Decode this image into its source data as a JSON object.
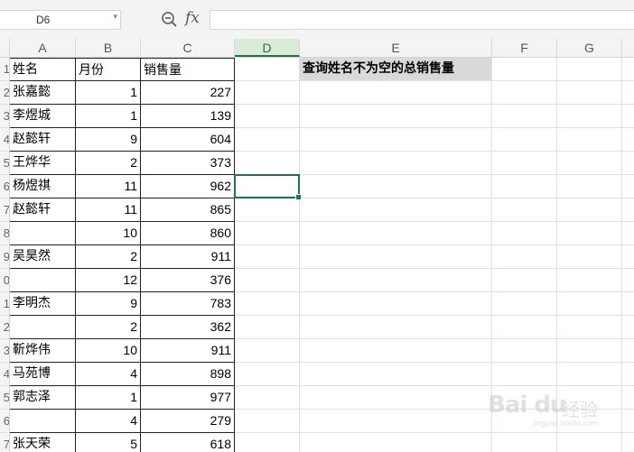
{
  "formula_bar": {
    "name_box": "D6",
    "fx_label": "fx",
    "formula": ""
  },
  "columns": [
    "A",
    "B",
    "C",
    "D",
    "E",
    "F",
    "G"
  ],
  "active_column": "D",
  "active_cell": "D6",
  "row_numbers": [
    "1",
    "2",
    "3",
    "4",
    "5",
    "6",
    "7",
    "8",
    "9",
    "0",
    "1",
    "2",
    "3",
    "4",
    "5",
    "6",
    "7"
  ],
  "table": {
    "headers": [
      "姓名",
      "月份",
      "销售量"
    ],
    "rows": [
      {
        "name": "张嘉懿",
        "month": "1",
        "sales": "227"
      },
      {
        "name": "李煜城",
        "month": "1",
        "sales": "139"
      },
      {
        "name": "赵懿轩",
        "month": "9",
        "sales": "604"
      },
      {
        "name": "王烨华",
        "month": "2",
        "sales": "373"
      },
      {
        "name": "杨煜祺",
        "month": "11",
        "sales": "962"
      },
      {
        "name": "赵懿轩",
        "month": "11",
        "sales": "865"
      },
      {
        "name": "",
        "month": "10",
        "sales": "860"
      },
      {
        "name": "吴昊然",
        "month": "2",
        "sales": "911"
      },
      {
        "name": "",
        "month": "12",
        "sales": "376"
      },
      {
        "name": "李明杰",
        "month": "9",
        "sales": "783"
      },
      {
        "name": "",
        "month": "2",
        "sales": "362"
      },
      {
        "name": "靳烨伟",
        "month": "10",
        "sales": "911"
      },
      {
        "name": "马苑博",
        "month": "4",
        "sales": "898"
      },
      {
        "name": "郭志泽",
        "month": "1",
        "sales": "977"
      },
      {
        "name": "",
        "month": "4",
        "sales": "279"
      },
      {
        "name": "张天荣",
        "month": "5",
        "sales": "618"
      }
    ]
  },
  "e1_label": "查询姓名不为空的总销售量",
  "watermark": {
    "brand": "Bai du",
    "cn": "经验",
    "url": "jingyan.baidu.com"
  }
}
